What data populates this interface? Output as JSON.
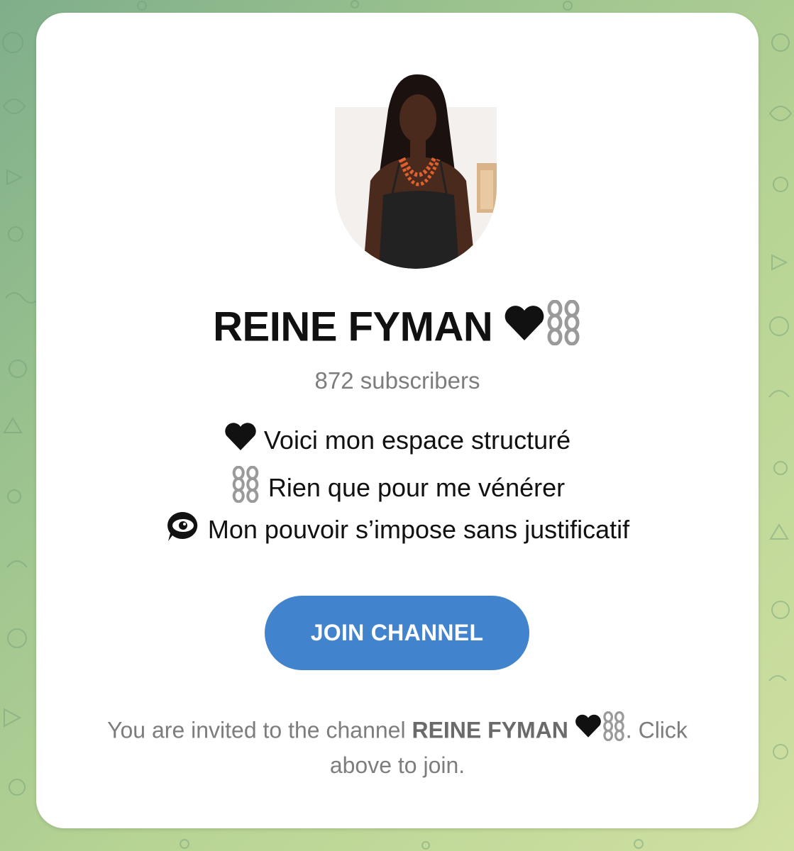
{
  "channel": {
    "title": "REINE FYMAN",
    "title_emoji": [
      "black-heart-icon",
      "chains-icon"
    ],
    "subscribers": "872 subscribers",
    "description": [
      {
        "icon": "black-heart-icon",
        "text": "Voici mon espace structuré"
      },
      {
        "icon": "chains-icon",
        "text": "Rien que pour me vénérer"
      },
      {
        "icon": "eye-in-speech-bubble-icon",
        "text": "Mon pouvoir s’impose sans justificatif"
      }
    ],
    "join_label": "JOIN CHANNEL",
    "invite": {
      "prefix": "You are invited to the channel",
      "name": "REINE FYMAN",
      "suffix_1": ". Click",
      "suffix_2": "above to join."
    }
  },
  "colors": {
    "button": "#4283cd",
    "card": "#ffffff",
    "muted_text": "#7d7d7d",
    "title_text": "#111111"
  }
}
